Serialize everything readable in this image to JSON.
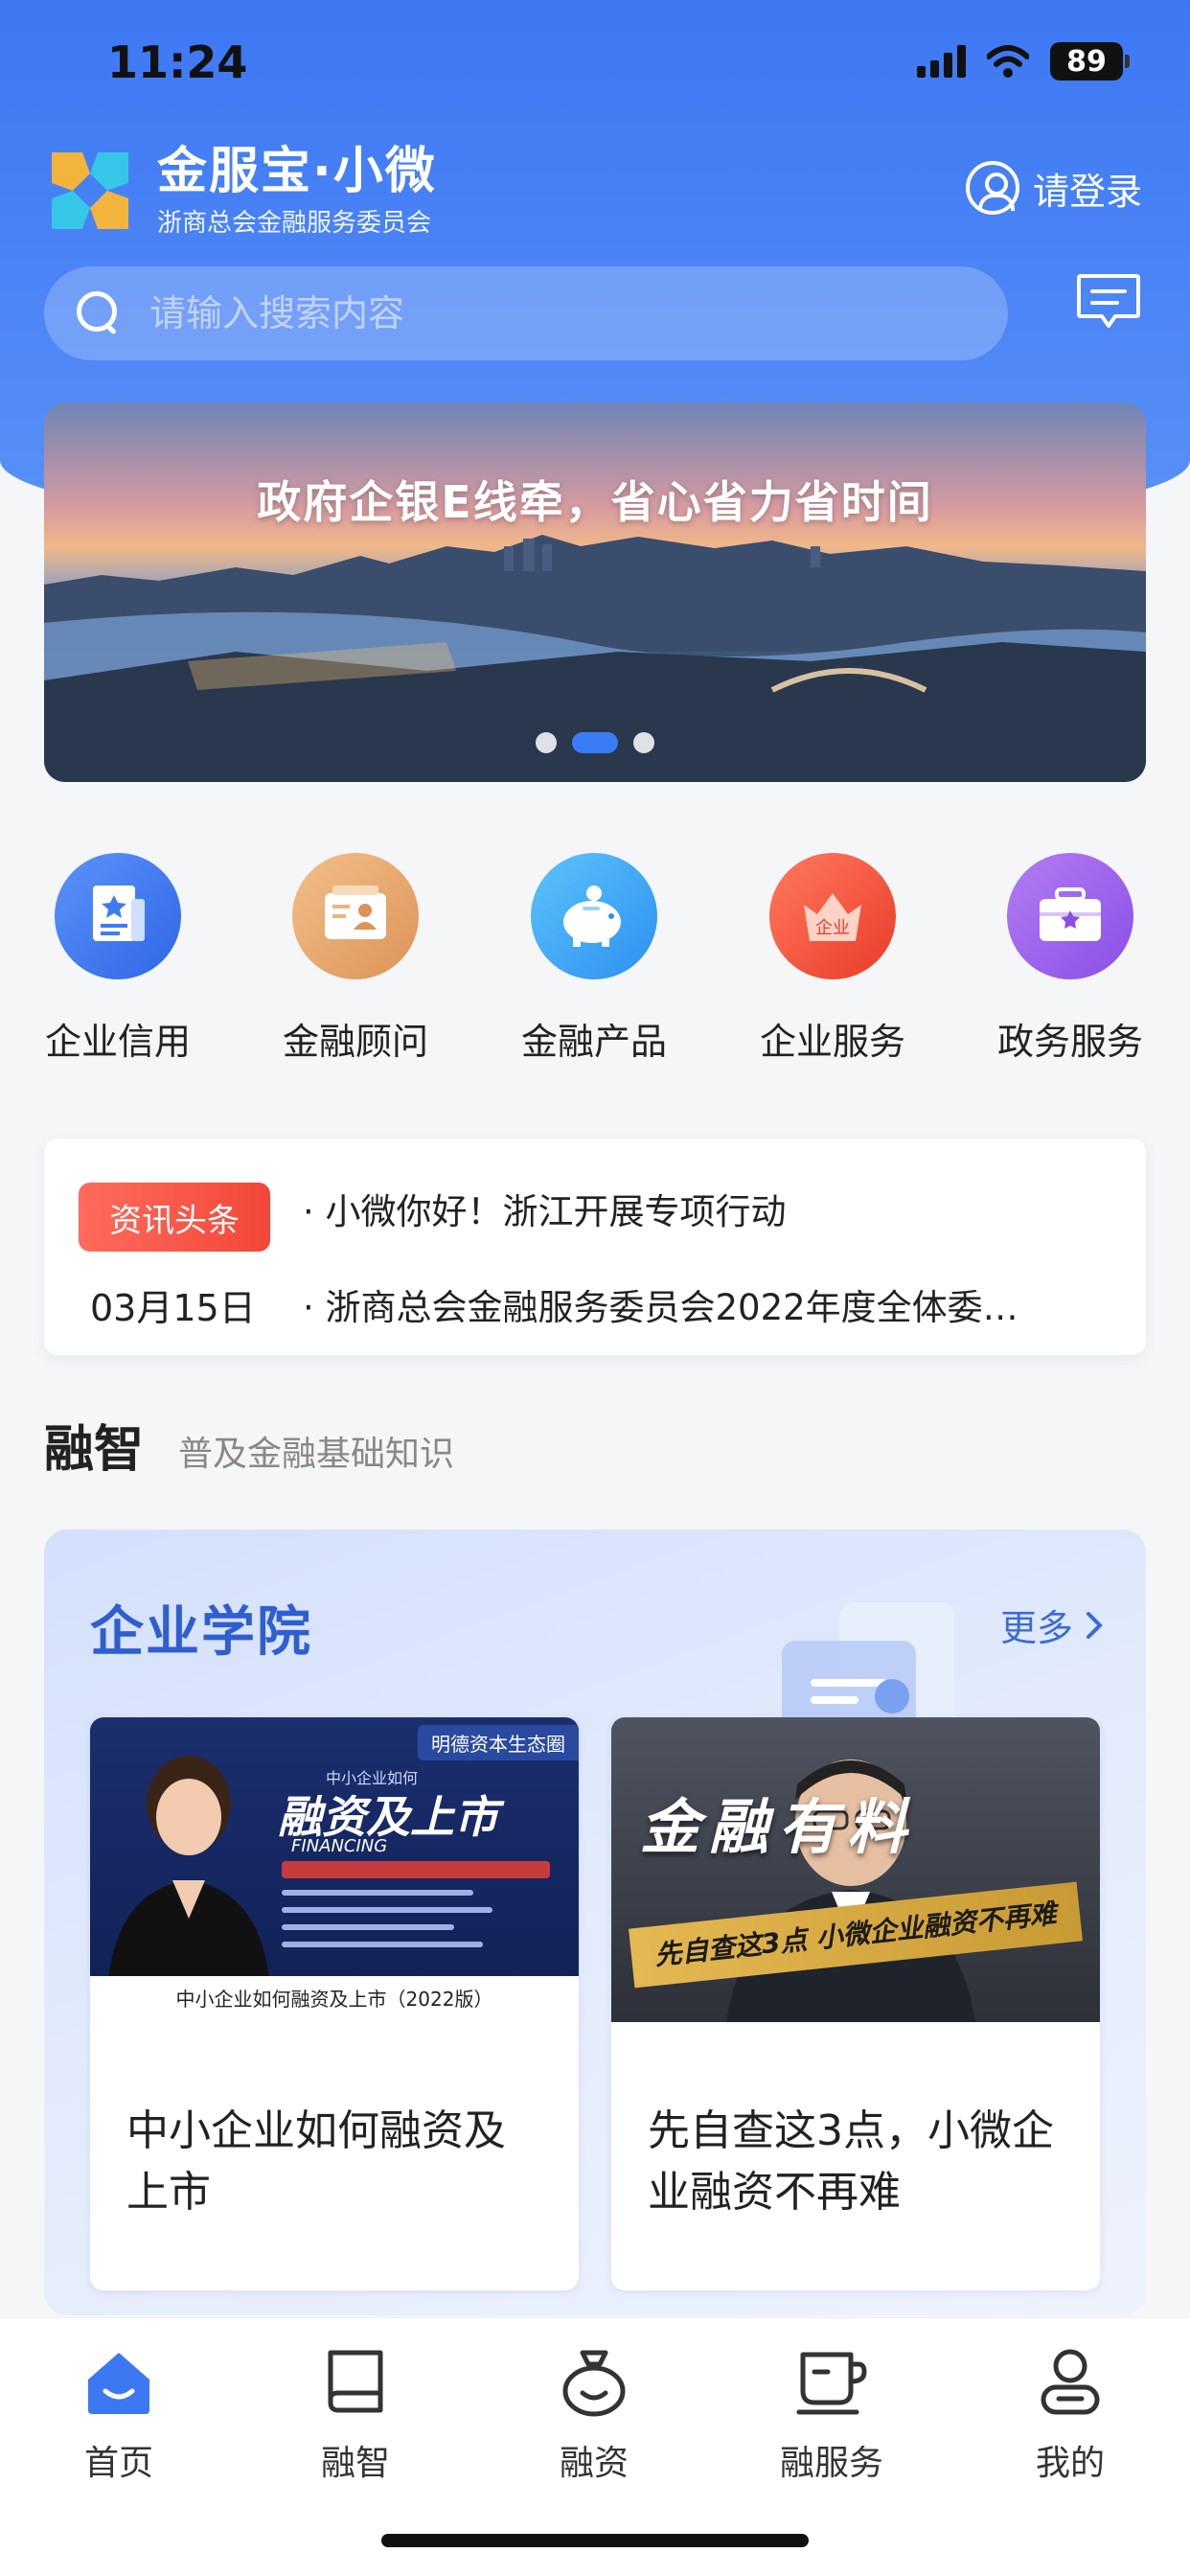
{
  "status": {
    "time": "11:24",
    "battery": "89"
  },
  "brand": {
    "title": "金服宝·小微",
    "subtitle": "浙商总会金融服务委员会"
  },
  "header": {
    "login_label": "请登录"
  },
  "search": {
    "placeholder": "请输入搜索内容"
  },
  "banner": {
    "title": "政府企银E线牵，省心省力省时间",
    "active_dot": 2,
    "dot_count": 3
  },
  "quick_actions": [
    {
      "label": "企业信用",
      "icon": "credit-icon",
      "color": "#3f7bf5"
    },
    {
      "label": "金融顾问",
      "icon": "advisor-icon",
      "color": "#e6a66f"
    },
    {
      "label": "金融产品",
      "icon": "piggy-bank-icon",
      "color": "#35a2f2"
    },
    {
      "label": "企业服务",
      "icon": "crown-icon",
      "color": "#f2553d"
    },
    {
      "label": "政务服务",
      "icon": "briefcase-icon",
      "color": "#9b63ec"
    }
  ],
  "news": {
    "badge": "资讯头条",
    "date": "03月15日",
    "items": [
      "· 小微你好！浙江开展专项行动",
      "· 浙商总会金融服务委员会2022年度全体委…"
    ]
  },
  "section": {
    "title": "融智",
    "subtitle": "普及金融基础知识"
  },
  "academy": {
    "title": "企业学院",
    "more": "更多",
    "cards": [
      {
        "title": "中小企业如何融资及上市",
        "thumb_caption": "中小企业如何融资及上市（2022版）",
        "thumb_brand": "明德资本生态圈",
        "thumb_headline": "融资及上市",
        "thumb_en": "FINANCING",
        "thumb_kicker": "中小企业如何"
      },
      {
        "title": "先自查这3点，小微企业融资不再难",
        "thumb_headline": "金融有料",
        "thumb_strip": "先自查这3点 小微企业融资不再难"
      }
    ]
  },
  "tabs": [
    {
      "label": "首页",
      "icon": "home-icon",
      "active": true
    },
    {
      "label": "融智",
      "icon": "book-icon",
      "active": false
    },
    {
      "label": "融资",
      "icon": "money-bag-icon",
      "active": false
    },
    {
      "label": "融服务",
      "icon": "cup-icon",
      "active": false
    },
    {
      "label": "我的",
      "icon": "profile-icon",
      "active": false
    }
  ],
  "colors": {
    "primary": "#3d78f3",
    "accent_red": "#f24738",
    "academy_blue": "#2f5fcf"
  }
}
